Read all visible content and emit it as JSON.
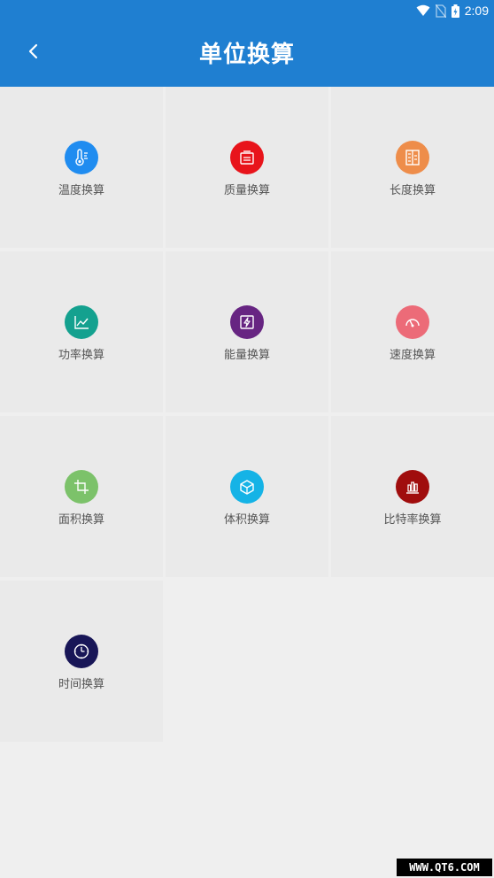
{
  "status_bar": {
    "time": "2:09"
  },
  "app_bar": {
    "title": "单位换算",
    "back_icon": "chevron-left-icon"
  },
  "tiles": [
    {
      "label": "温度换算",
      "icon": "thermometer-icon",
      "color": "#1f8cf0"
    },
    {
      "label": "质量换算",
      "icon": "scale-icon",
      "color": "#e8141b"
    },
    {
      "label": "长度换算",
      "icon": "ruler-icon",
      "color": "#ee8d4a"
    },
    {
      "label": "功率换算",
      "icon": "line-chart-icon",
      "color": "#14a18f"
    },
    {
      "label": "能量换算",
      "icon": "lightning-icon",
      "color": "#672582"
    },
    {
      "label": "速度换算",
      "icon": "speedometer-icon",
      "color": "#ec6b78"
    },
    {
      "label": "面积换算",
      "icon": "crop-icon",
      "color": "#7cc26a"
    },
    {
      "label": "体积换算",
      "icon": "cube-icon",
      "color": "#15b3e6"
    },
    {
      "label": "比特率换算",
      "icon": "bar-chart-icon",
      "color": "#a00d0d"
    },
    {
      "label": "时间换算",
      "icon": "clock-icon",
      "color": "#181657"
    }
  ],
  "watermark": "WWW.QT6.COM",
  "colors": {
    "primary": "#1f7fd1",
    "background": "#efefef",
    "tile": "#eaeaea"
  }
}
